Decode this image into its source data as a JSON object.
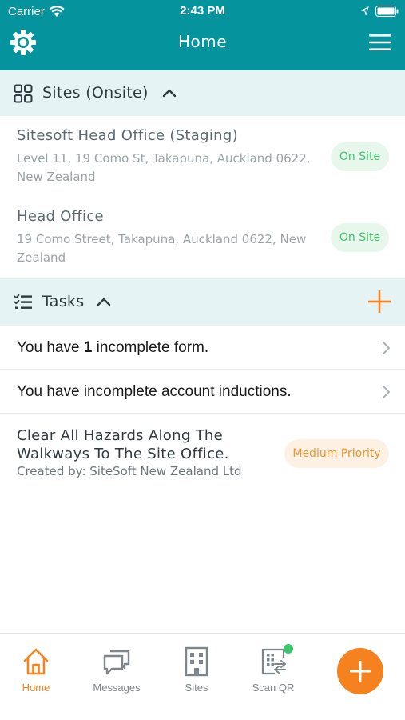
{
  "status_bar": {
    "carrier": "Carrier",
    "time": "2:43 PM"
  },
  "nav": {
    "title": "Home",
    "left_icon": "gear-icon",
    "right_icon": "hamburger-menu-icon"
  },
  "sites_section": {
    "title": "Sites (Onsite)",
    "icon": "grid-icon",
    "expanded": true,
    "items": [
      {
        "name": "Sitesoft Head Office (Staging)",
        "address": "Level 11, 19 Como St, Takapuna, Auckland 0622, New Zealand",
        "status": "On Site"
      },
      {
        "name": "Head Office",
        "address": "19 Como Street, Takapuna, Auckland 0622, New Zealand",
        "status": "On Site"
      }
    ]
  },
  "tasks_section": {
    "title": "Tasks",
    "icon": "checklist-icon",
    "expanded": true,
    "items": [
      {
        "prefix": "You have ",
        "count": "1",
        "suffix": " incomplete form."
      },
      {
        "text": "You have incomplete account inductions."
      }
    ],
    "hazard": {
      "title": "Clear All Hazards Along The Walkways To The Site Office.",
      "created_by": "Created by: SiteSoft New Zealand Ltd",
      "priority": "Medium Priority"
    }
  },
  "tab_bar": {
    "tabs": [
      {
        "label": "Home",
        "icon": "home-icon",
        "active": true
      },
      {
        "label": "Messages",
        "icon": "chat-icon",
        "active": false
      },
      {
        "label": "Sites",
        "icon": "building-icon",
        "active": false
      },
      {
        "label": "Scan QR",
        "icon": "qr-scan-icon",
        "active": false,
        "notification": true
      }
    ],
    "fab_icon": "plus-icon"
  },
  "colors": {
    "header_teal": "#05939e",
    "section_bg": "#e5f3f5",
    "accent_orange": "#f5821f",
    "onsite_green": "#3ec46a",
    "priority_orange": "#f0962e"
  }
}
